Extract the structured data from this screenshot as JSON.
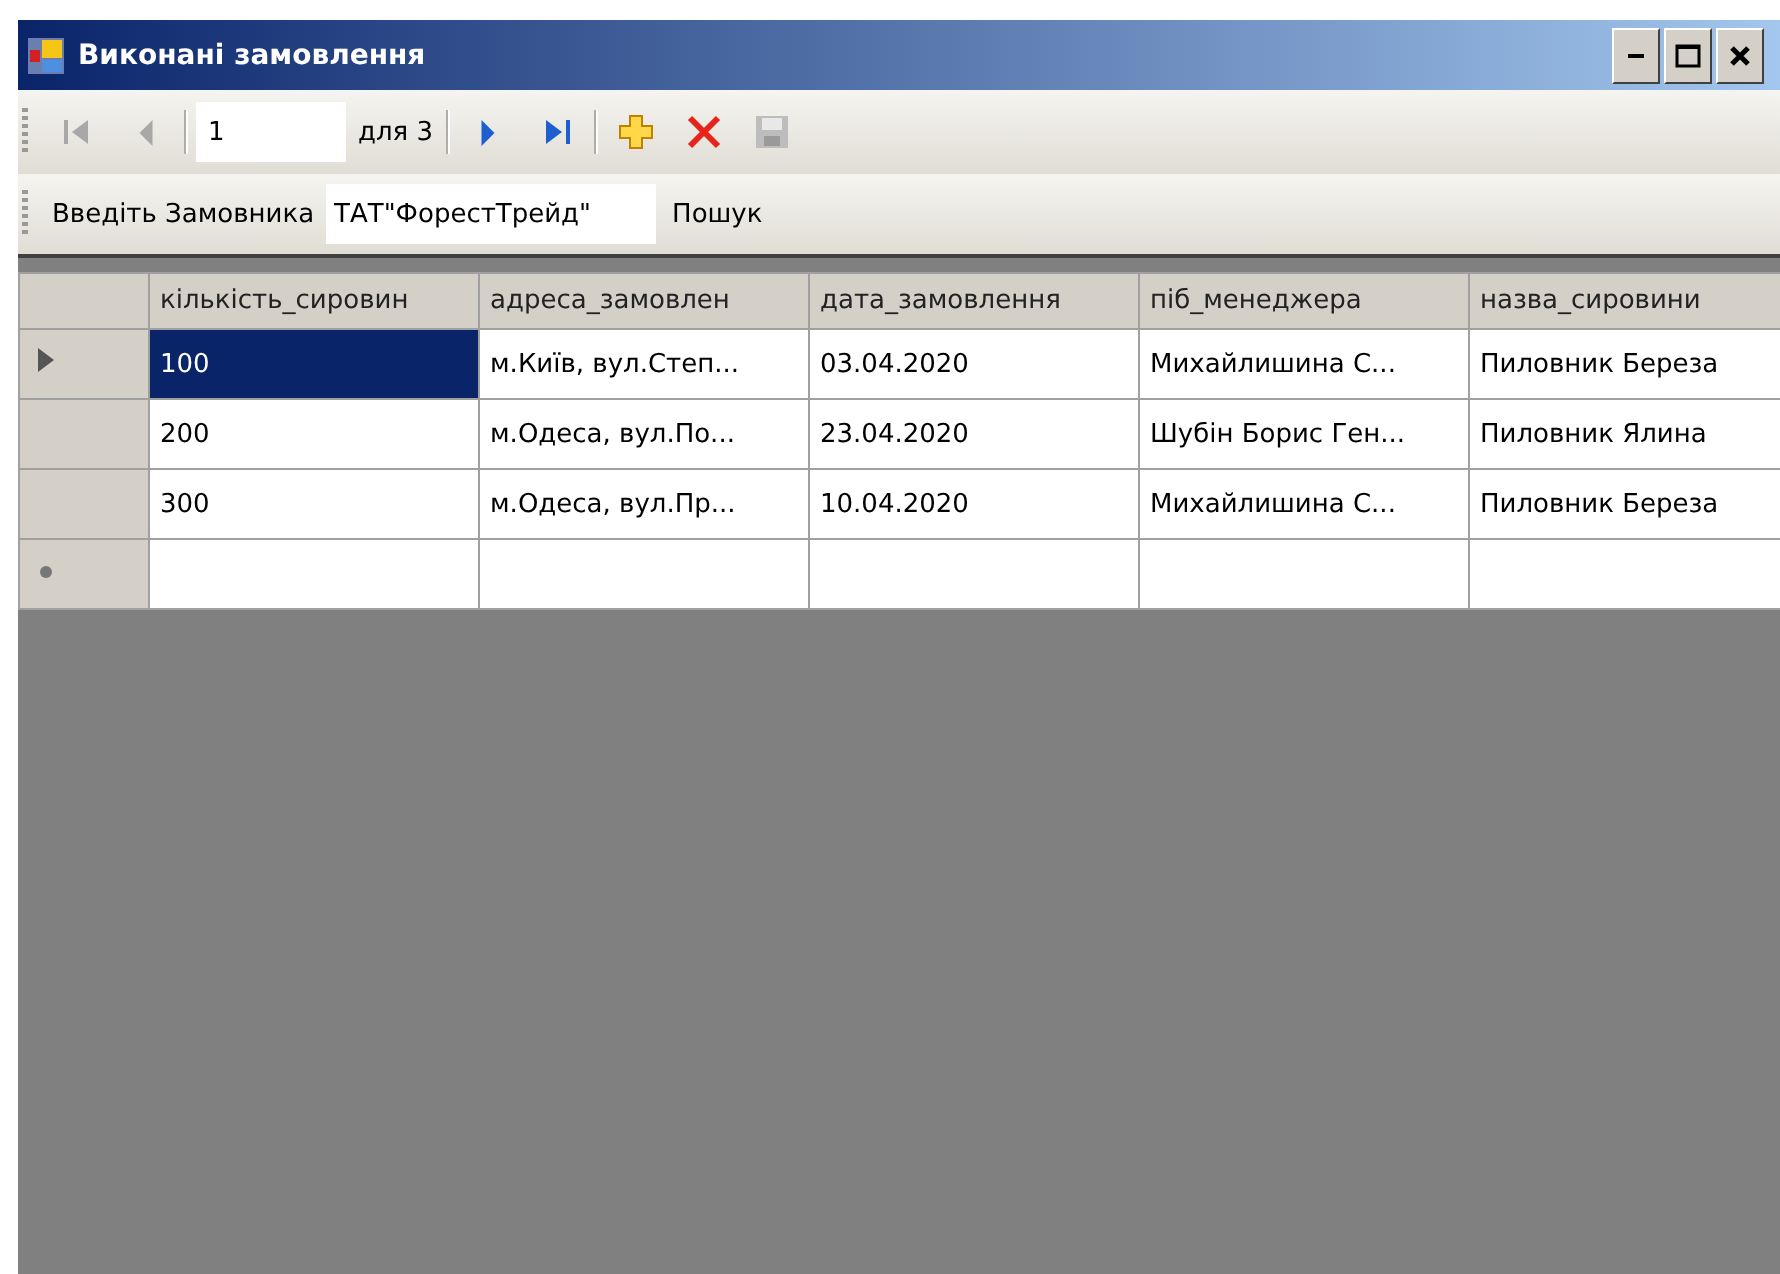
{
  "window": {
    "title": "Виконані замовлення"
  },
  "navigator": {
    "items": [
      {
        "kind": "first",
        "disabled": true
      },
      {
        "kind": "prev",
        "disabled": true
      },
      {
        "kind": "sep"
      },
      {
        "kind": "position",
        "value": "1"
      },
      {
        "kind": "label",
        "text": "для 3"
      },
      {
        "kind": "sep"
      },
      {
        "kind": "next",
        "disabled": false
      },
      {
        "kind": "last",
        "disabled": false
      },
      {
        "kind": "sep"
      },
      {
        "kind": "add",
        "disabled": false
      },
      {
        "kind": "delete",
        "disabled": false
      },
      {
        "kind": "save",
        "disabled": true
      }
    ]
  },
  "search_bar": {
    "label": "Введіть Замовника",
    "value": "ТАТ\"ФорестТрейд\"",
    "button": "Пошук"
  },
  "table": {
    "columns": [
      "кількість_сировин",
      "адреса_замовлен",
      "дата_замовлення",
      "піб_менеджера",
      "назва_сировини"
    ],
    "rows": [
      {
        "kind": "data",
        "current": true,
        "cells": [
          {
            "text": "100",
            "selected": true
          },
          {
            "text": "м.Київ, вул.Степ...",
            "selected": false
          },
          {
            "text": "03.04.2020",
            "selected": false
          },
          {
            "text": "Михайлишина С...",
            "selected": false
          },
          {
            "text": "Пиловник Береза",
            "selected": false
          }
        ]
      },
      {
        "kind": "data",
        "current": false,
        "cells": [
          {
            "text": "200",
            "selected": false
          },
          {
            "text": "м.Одеса, вул.По...",
            "selected": false
          },
          {
            "text": "23.04.2020",
            "selected": false
          },
          {
            "text": "Шубін Борис Ген...",
            "selected": false
          },
          {
            "text": "Пиловник Ялина",
            "selected": false
          }
        ]
      },
      {
        "kind": "data",
        "current": false,
        "cells": [
          {
            "text": "300",
            "selected": false
          },
          {
            "text": "м.Одеса, вул.Пр...",
            "selected": false
          },
          {
            "text": "10.04.2020",
            "selected": false
          },
          {
            "text": "Михайлишина С...",
            "selected": false
          },
          {
            "text": "Пиловник Береза",
            "selected": false
          }
        ]
      },
      {
        "kind": "new"
      }
    ]
  }
}
